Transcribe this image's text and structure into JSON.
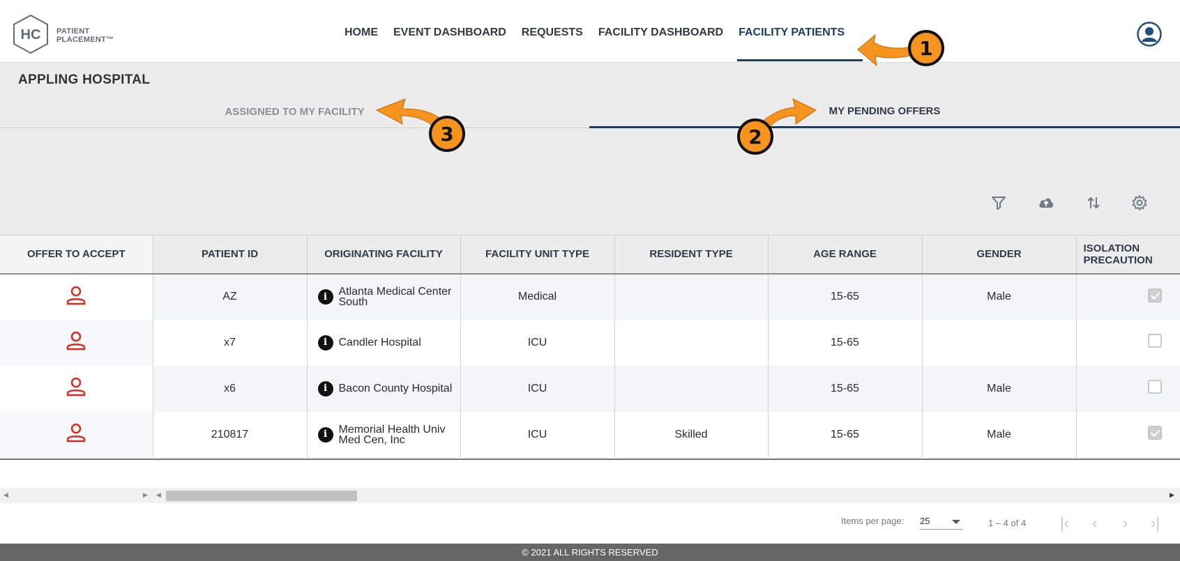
{
  "logo": {
    "letters": "HC",
    "line1": "PATIENT",
    "line2": "PLACEMENT™"
  },
  "nav": {
    "items": [
      "HOME",
      "EVENT DASHBOARD",
      "REQUESTS",
      "FACILITY DASHBOARD",
      "FACILITY PATIENTS"
    ],
    "active": "FACILITY PATIENTS"
  },
  "hospital_name": "APPLING HOSPITAL",
  "tabs": {
    "assigned": "ASSIGNED TO MY FACILITY",
    "pending": "MY PENDING OFFERS",
    "active": "MY PENDING OFFERS"
  },
  "toolbar": {
    "icons": [
      "filter-icon",
      "cloud-upload-icon",
      "sort-icon",
      "settings-gear-icon"
    ]
  },
  "table": {
    "headers": [
      "OFFER TO ACCEPT",
      "PATIENT ID",
      "ORIGINATING FACILITY",
      "FACILITY UNIT TYPE",
      "RESIDENT TYPE",
      "AGE RANGE",
      "GENDER",
      "ISOLATION PRECAUTION"
    ],
    "rows": [
      {
        "patient_id": "AZ",
        "facility": "Atlanta Medical Center South",
        "unit_type": "Medical",
        "resident_type": "",
        "age_range": "15-65",
        "gender": "Male",
        "isolation": true
      },
      {
        "patient_id": "x7",
        "facility": "Candler Hospital",
        "unit_type": "ICU",
        "resident_type": "",
        "age_range": "15-65",
        "gender": "",
        "isolation": false
      },
      {
        "patient_id": "x6",
        "facility": "Bacon County Hospital",
        "unit_type": "ICU",
        "resident_type": "",
        "age_range": "15-65",
        "gender": "Male",
        "isolation": false
      },
      {
        "patient_id": "210817",
        "facility": "Memorial Health Univ Med Cen, Inc",
        "unit_type": "ICU",
        "resident_type": "Skilled",
        "age_range": "15-65",
        "gender": "Male",
        "isolation": true
      }
    ]
  },
  "paginator": {
    "label": "Items per page:",
    "page_size": "25",
    "range": "1 – 4 of 4"
  },
  "footer": "© 2021 ALL RIGHTS RESERVED",
  "annotations": [
    "1",
    "2",
    "3"
  ],
  "colors": {
    "accent": "#1c3d63",
    "person_icon": "#d62b20",
    "annotation": "#f7941d"
  }
}
